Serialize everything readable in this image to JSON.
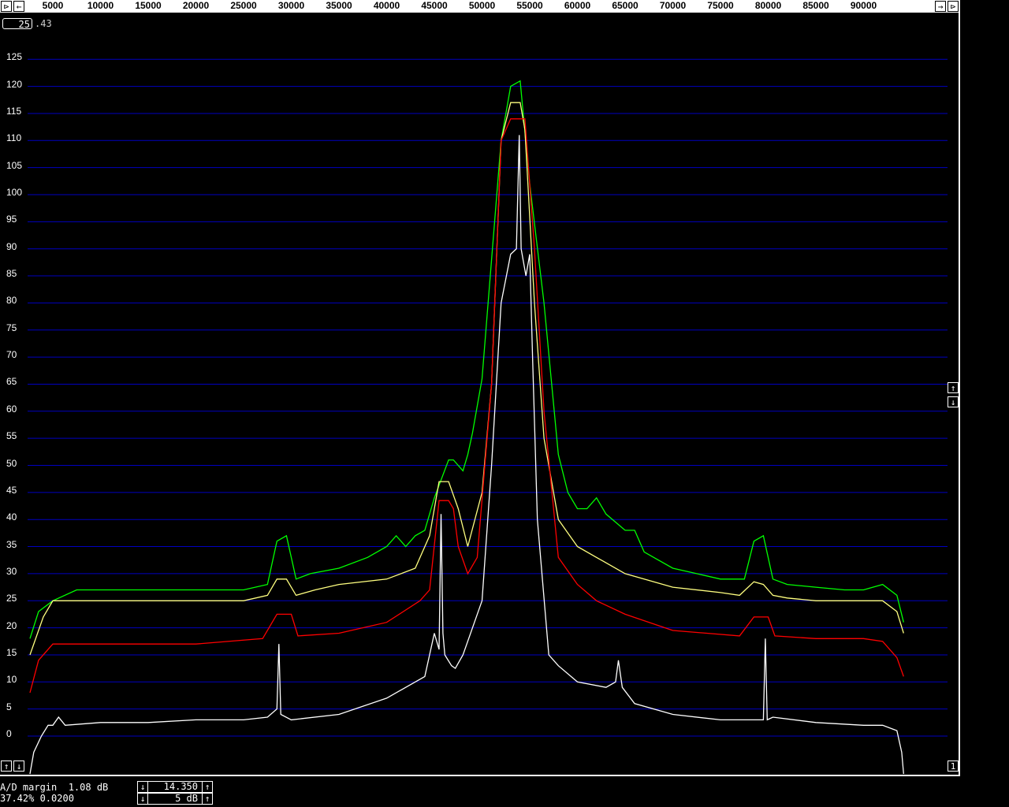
{
  "toolbar": {
    "left_scroll_icon": "⊳",
    "left_arrow_icon": "←",
    "right_arrow_icon": "→",
    "right_scroll_icon": "⊳"
  },
  "frame": {
    "value": "25",
    "suffix": ".43"
  },
  "side_buttons": {
    "up_icon": "↑",
    "down_icon": "↓"
  },
  "bottom_buttons": {
    "left_up_icon": "↑",
    "left_down_icon": "↓",
    "right_label": "1"
  },
  "status": {
    "line1": "A/D margin  1.08 dB",
    "line2": "37.42% 0.0200"
  },
  "controls": {
    "top_value": "14.350",
    "bottom_value": "5 dB",
    "down_icon": "↓",
    "up_icon": "↑"
  },
  "colors": {
    "background": "#000000",
    "grid": "#0000c0",
    "green": "#00ff00",
    "yellow": "#ffff80",
    "red": "#ff0000",
    "white": "#ffffff"
  },
  "chart_data": {
    "type": "line",
    "x_ticks": [
      5000,
      10000,
      15000,
      20000,
      25000,
      30000,
      35000,
      40000,
      45000,
      50000,
      55000,
      60000,
      65000,
      70000,
      75000,
      80000,
      85000,
      90000
    ],
    "y_ticks": [
      0,
      5,
      10,
      15,
      20,
      25,
      30,
      35,
      40,
      45,
      50,
      55,
      60,
      65,
      70,
      75,
      80,
      85,
      90,
      95,
      100,
      105,
      110,
      115,
      120,
      125
    ],
    "xlim": [
      2500,
      97000
    ],
    "ylim": [
      -7,
      132
    ],
    "grid": true,
    "series": [
      {
        "color": "#00ff00",
        "x": [
          2600,
          3500,
          5000,
          7500,
          10000,
          15000,
          20000,
          25000,
          27500,
          28500,
          29500,
          30500,
          32000,
          35000,
          38000,
          40000,
          41000,
          42000,
          43000,
          44000,
          45000,
          46500,
          47000,
          48000,
          48500,
          49000,
          50000,
          51000,
          52000,
          53000,
          54000,
          55000,
          56500,
          58000,
          59000,
          60000,
          61000,
          62000,
          63000,
          65000,
          66000,
          67000,
          68000,
          70000,
          72500,
          75000,
          77500,
          78500,
          79500,
          80500,
          82000,
          85000,
          88000,
          90000,
          92000,
          93500,
          94200
        ],
        "y": [
          18,
          23,
          25,
          27,
          27,
          27,
          27,
          27,
          28,
          36,
          37,
          29,
          30,
          31,
          33,
          35,
          37,
          35,
          37,
          38,
          44,
          51,
          51,
          49,
          52,
          56,
          66,
          88,
          110,
          120,
          121,
          102,
          80,
          52,
          45,
          42,
          42,
          44,
          41,
          38,
          38,
          34,
          33,
          31,
          30,
          29,
          29,
          36,
          37,
          29,
          28,
          27.5,
          27,
          27,
          28,
          26,
          21
        ]
      },
      {
        "color": "#ffff80",
        "x": [
          2600,
          4000,
          5000,
          10000,
          15000,
          20000,
          25000,
          27500,
          28500,
          29500,
          30500,
          32500,
          35000,
          40000,
          43000,
          44500,
          45500,
          46500,
          47500,
          48500,
          50000,
          51000,
          52000,
          53000,
          54000,
          54500,
          55500,
          56500,
          58000,
          60000,
          62000,
          65000,
          70000,
          75000,
          77000,
          78500,
          79500,
          80500,
          82000,
          85000,
          88000,
          90000,
          92000,
          93500,
          94200
        ],
        "y": [
          15,
          22,
          25,
          25,
          25,
          25,
          25,
          26,
          29,
          29,
          26,
          27,
          28,
          29,
          31,
          37,
          47,
          47,
          42,
          35,
          45,
          65,
          110,
          117,
          117,
          112,
          80,
          55,
          40,
          35,
          33,
          30,
          27.5,
          26.5,
          26,
          28.5,
          28,
          26,
          25.5,
          25,
          25,
          25,
          25,
          23,
          19
        ]
      },
      {
        "color": "#ff0000",
        "x": [
          2600,
          3500,
          5000,
          10000,
          20000,
          27000,
          28500,
          30000,
          30700,
          35000,
          40000,
          43500,
          44500,
          45500,
          46500,
          47000,
          47500,
          48500,
          49500,
          51000,
          52000,
          53000,
          54500,
          55500,
          56500,
          58000,
          60000,
          62000,
          65000,
          70000,
          77000,
          78500,
          80000,
          80700,
          85000,
          90000,
          92000,
          93500,
          94200
        ],
        "y": [
          8,
          14,
          17,
          17,
          17,
          18,
          22.5,
          22.5,
          18.5,
          19,
          21,
          25,
          27,
          43.5,
          43.5,
          42,
          35,
          30,
          33,
          65,
          110,
          114,
          114,
          90,
          60,
          33,
          28,
          25,
          22.5,
          19.5,
          18.5,
          22,
          22,
          18.5,
          18,
          18,
          17.5,
          14.5,
          11
        ]
      },
      {
        "color": "#ffffff",
        "x": [
          2600,
          3000,
          3800,
          4500,
          5000,
          5600,
          6300,
          10000,
          15000,
          20000,
          25000,
          27500,
          28500,
          28700,
          28900,
          30000,
          35000,
          40000,
          42000,
          43000,
          44000,
          45000,
          45500,
          45700,
          45900,
          46100,
          46800,
          47200,
          48000,
          50000,
          51000,
          52000,
          53000,
          53600,
          53900,
          54100,
          54600,
          55000,
          55300,
          55800,
          57000,
          58000,
          60000,
          63000,
          64000,
          64300,
          64700,
          66000,
          70000,
          75000,
          78000,
          79500,
          79700,
          79900,
          80500,
          85000,
          90000,
          92000,
          93500,
          94000,
          94200
        ],
        "y": [
          -7,
          -3,
          0,
          2,
          2,
          3.5,
          2,
          2.5,
          2.5,
          3,
          3,
          3.5,
          5,
          17,
          4,
          3,
          4,
          7,
          9,
          10,
          11,
          19,
          16,
          41,
          19,
          15,
          13,
          12.5,
          15,
          25,
          50,
          80,
          89,
          90,
          111,
          90,
          85,
          89,
          70,
          40,
          15,
          13,
          10,
          9,
          10,
          14,
          9,
          6,
          4,
          3,
          3,
          3,
          18,
          3,
          3.5,
          2.5,
          2,
          2,
          1,
          -3,
          -7
        ]
      }
    ]
  }
}
